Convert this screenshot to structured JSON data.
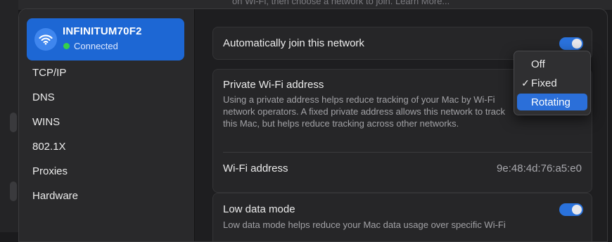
{
  "background": {
    "partial_text": "on Wi-Fi, then choose a network to join. Learn More..."
  },
  "sidebar": {
    "network": {
      "name": "INFINITUM70F2",
      "status": "Connected",
      "status_color": "#35d04a",
      "icon": "wifi-icon"
    },
    "items": [
      {
        "label": "TCP/IP"
      },
      {
        "label": "DNS"
      },
      {
        "label": "WINS"
      },
      {
        "label": "802.1X"
      },
      {
        "label": "Proxies"
      },
      {
        "label": "Hardware"
      }
    ]
  },
  "settings": {
    "auto_join": {
      "label": "Automatically join this network",
      "enabled": true
    },
    "private_address": {
      "label": "Private Wi-Fi address",
      "description": "Using a private address helps reduce tracking of your Mac by Wi-Fi network operators. A fixed private address allows this network to track this Mac, but helps reduce tracking across other networks."
    },
    "wifi_address": {
      "label": "Wi-Fi address",
      "value": "9e:48:4d:76:a5:e0"
    },
    "low_data_mode": {
      "label": "Low data mode",
      "description": "Low data mode helps reduce your Mac data usage over specific Wi-Fi",
      "enabled": true
    }
  },
  "dropdown_menu": {
    "options": [
      {
        "label": "Off",
        "checked": false,
        "highlighted": false
      },
      {
        "label": "Fixed",
        "checked": true,
        "highlighted": false
      },
      {
        "label": "Rotating",
        "checked": false,
        "highlighted": true
      }
    ],
    "check_glyph": "✓"
  },
  "colors": {
    "accent": "#2b6fd9",
    "toggle_on": "#2a72dc",
    "selected_network": "#1d67d4"
  }
}
